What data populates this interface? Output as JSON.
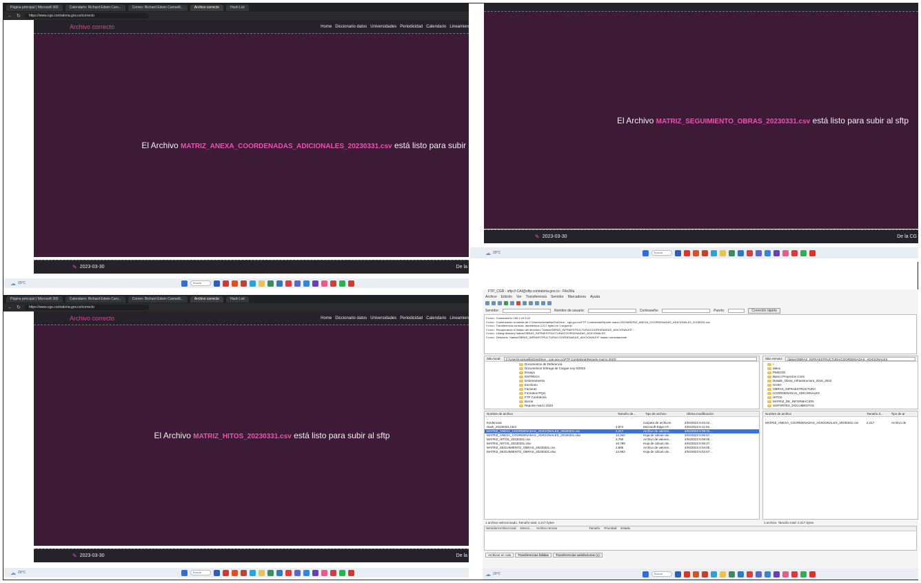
{
  "browser": {
    "tabs": [
      "Página principal | Microsoft 365",
      "Calendario: Richard Edwin Carv...",
      "Correo: Richard Edwin Camarill...",
      "Archivo correcto",
      "Hash List"
    ],
    "url": "https://www.cge.contraloria.gov.co/correcto"
  },
  "site": {
    "title": "Archivo correcto",
    "nav": [
      "Home",
      "Diccionario datos",
      "Universidades",
      "Periodicidad",
      "Calendario",
      "Lineamien"
    ],
    "msg_prefix": "El Archivo",
    "msg_suffix_top_left": "está listo para subir",
    "msg_suffix_full": "está listo para subir al sftp",
    "files": {
      "top_left": "MATRIZ_ANEXA_COORDENADAS_ADICIONALES_20230331.csv",
      "top_right": "MATRIZ_SEGUIMIENTO_OBRAS_20230331.csv",
      "bottom_left": "MATRIZ_HITOS_20230331.csv"
    },
    "footer_date": "2023-03-30",
    "footer_right_left": "De la",
    "footer_right_right": "De la CG"
  },
  "taskbar": {
    "weather_temp": "29°C",
    "weather_desc": "Mayormente nublado",
    "search": "Buscar",
    "icon_colors": [
      "#2f6fd6",
      "#333",
      "#2b5fb8",
      "#d9352b",
      "#e0501e",
      "#c7402c",
      "#2aa3d8",
      "#ecc34a",
      "#3b8d5a",
      "#2d7bc4",
      "#e23b3b",
      "#5a66c9",
      "#2e8ad8",
      "#6a3fb5",
      "#e95a86",
      "#d93a3a",
      "#2bb14f",
      "#d9352b"
    ]
  },
  "filezilla": {
    "title": "FTP_CGR - sftp://-CAI@sftp.contraloria.gov.co - FileZilla",
    "menu": [
      "Archivo",
      "Edición",
      "Ver",
      "Transferencia",
      "Servidor",
      "Marcadores",
      "Ayuda"
    ],
    "quick": {
      "host_label": "Servidor:",
      "user_label": "Nombre de usuario:",
      "pass_label": "Contraseña:",
      "port_label": "Puerto:",
      "connect": "Conexión rápida"
    },
    "log": [
      {
        "k": "Estado:",
        "v": "Connected to 190.1.10.3:22"
      },
      {
        "k": "Estado:",
        "v": "Comenzando la subida de C:\\Users\\rcamarilla\\OneDrive - cge.gov.co\\FTP Contraloria\\Reporte marzo 2023\\MATRIZ_ANEXA_COORDENADAS_ADICIONALES_20230331.csv"
      },
      {
        "k": "Estado:",
        "v": "Transferencia correcta, transferidos 2,217 bytes en 1 segundo"
      },
      {
        "k": "Estado:",
        "v": "Recuperando el listado del directorio \"/datos/OBRAS_INFRAESTRUCTURA/COORDENADAS_ADICIONALES\"..."
      },
      {
        "k": "Estado:",
        "v": "Listing directory /datos/OBRAS_INFRAESTRUCTURA/COORDENADAS_ADICIONALES"
      },
      {
        "k": "Estado:",
        "v": "Directorio \"/datos/OBRAS_INFRAESTRUCTURA/COORDENADAS_ADICIONALES\" listado correctamente"
      }
    ],
    "local": {
      "label": "Sitio local:",
      "path": "C:\\Users\\rcamarilla\\OneDrive - cge.gov.co\\FTP Contraloria\\Reporte marzo 2023\\",
      "tree": [
        "Documentos de Referencia",
        "Documentos Entrega de Cargue Ley 0/2023",
        "Ensayo",
        "ENTREGA",
        "Entrenamiento",
        "Escritorio",
        "Facturas",
        "Formatos PQrs",
        "FTP Contraloria",
        "Borrar",
        "Reporte marzo 2023"
      ],
      "cols": [
        "Nombre de archivo",
        "Tamaño de...",
        "Tipo de archivo",
        "Última modificación"
      ],
      "files": [
        {
          "name": "..",
          "size": "",
          "type": "",
          "date": ""
        },
        {
          "name": "Evidencias",
          "size": "",
          "type": "Carpeta de archivos",
          "date": "4/04/2023 5:04:42..."
        },
        {
          "name": "Hash_20230331.html",
          "size": "4,874",
          "type": "Microsoft Edge HT...",
          "date": "4/04/2023 5:11:03..."
        },
        {
          "name": "MATRIZ_ANEXA_COORDENADAS_ADICIONALES_20230331.csv",
          "size": "2,217",
          "type": "Archivo de valores...",
          "date": "4/04/2023 5:09:33..."
        },
        {
          "name": "MATRIZ_ANEXA_COORDENADAS_ADICIONALES_20230331.xlsx",
          "size": "12,342",
          "type": "Hoja de cálculo de...",
          "date": "4/04/2023 5:05:57..."
        },
        {
          "name": "MATRIZ_HITOS_20230331.csv",
          "size": "3,780",
          "type": "Archivo de valores...",
          "date": "4/04/2023 5:09:00..."
        },
        {
          "name": "MATRIZ_HITOS_20230331.xlsx",
          "size": "10,799",
          "type": "Hoja de cálculo de...",
          "date": "4/04/2023 5:06:27..."
        },
        {
          "name": "MATRIZ_SEGUIMIENTO_OBRAS_20230331.csv",
          "size": "2,885",
          "type": "Archivo de valores...",
          "date": "4/04/2023 5:04:00..."
        },
        {
          "name": "MATRIZ_SEGUIMIENTO_OBRAS_20230331.xlsx",
          "size": "14,993",
          "type": "Hoja de cálculo de...",
          "date": "4/04/2023 5:02:57..."
        }
      ],
      "status": "1 archivo seleccionado. Tamaño total: 2,217 bytes"
    },
    "remote": {
      "label": "Sitio remoto:",
      "path": "/datos/OBRAS_INFRAESTRUCTURA/COORDENADAS_ADICIONALES",
      "tree": [
        "/",
        "datos",
        "PMIGOO",
        "Banco Proyectos Conti",
        "Detalle_Obras_Infraestructura_2016_2022",
        "HASH",
        "OBRAS_INFRAESTRUCTURA",
        "COORDENADAS_ADICIONALES",
        "HITOS",
        "MATRIZ_DE_INFORMACION",
        "SOPORTES_DOCUMENTOS"
      ],
      "cols": [
        "Nombre de archivo",
        "Tamaño d...",
        "Tipo de ar"
      ],
      "files": [
        {
          "name": "..",
          "size": "",
          "type": ""
        },
        {
          "name": "MATRIZ_ANEXA_COORDENADAS_ADICIONALES_20230331.csv",
          "size": "2,217",
          "type": "Archivo de"
        }
      ],
      "status": "1 archivo. Tamaño total: 2,217 bytes"
    },
    "queue_cols": [
      "Servidor/Archivo local",
      "Direcci...",
      "Archivo remoto",
      "Tamaño",
      "Prioridad",
      "Estado"
    ],
    "queue_tabs": [
      "Archivos en cola",
      "Transferencias fallidas",
      "Transferencias satisfactorias (1)"
    ]
  }
}
